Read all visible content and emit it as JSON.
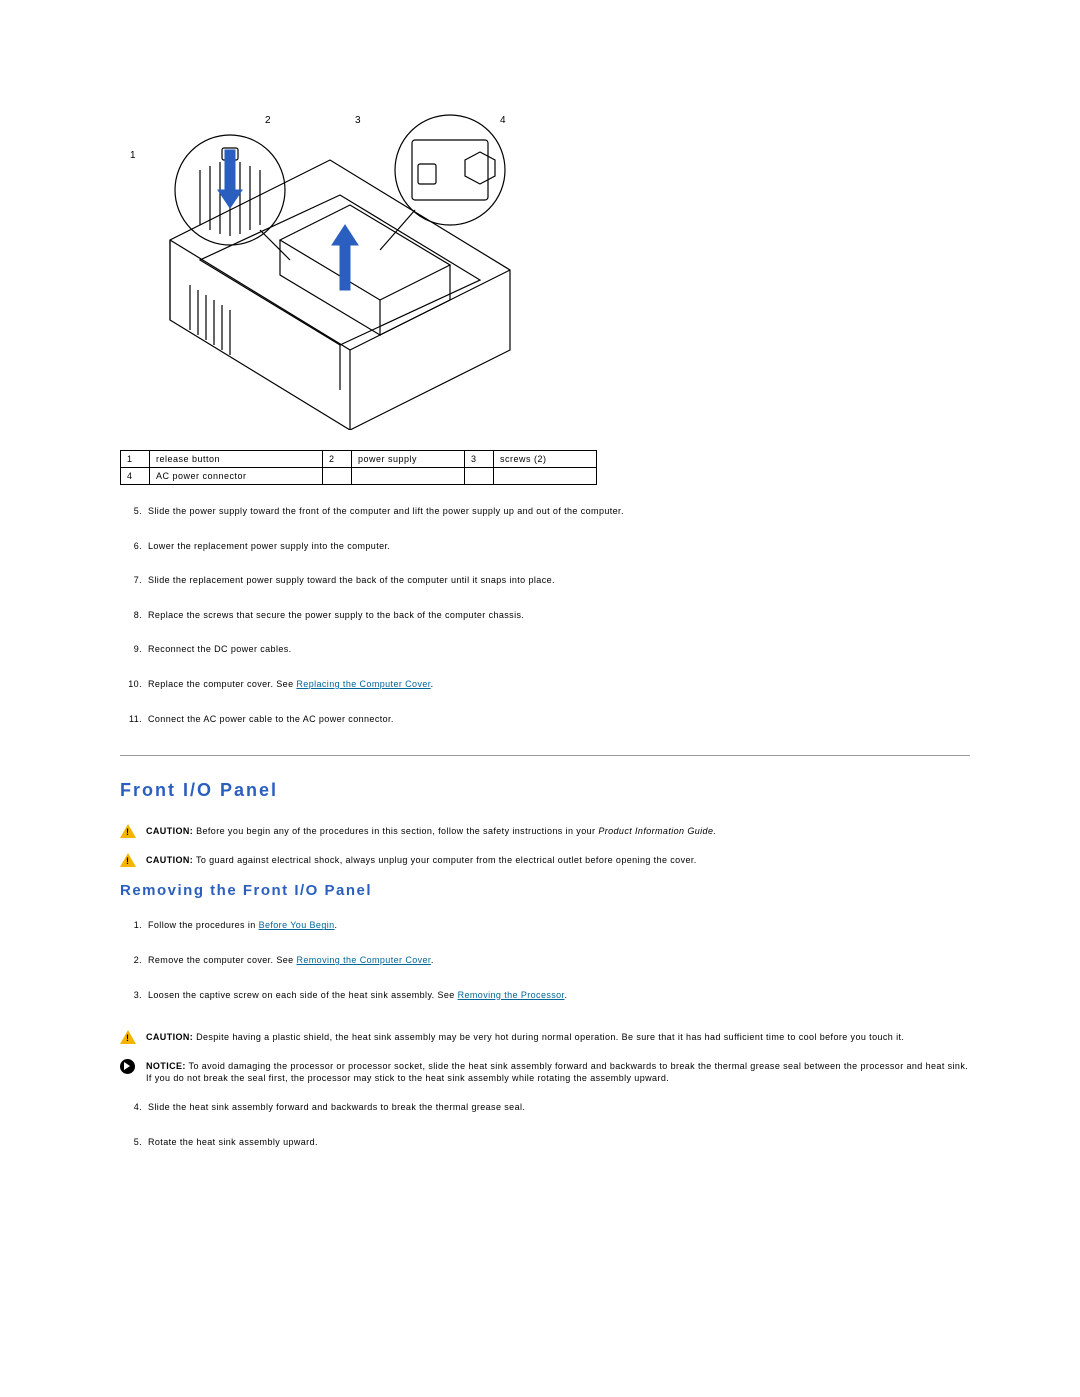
{
  "figure": {
    "callouts": {
      "c1": "1",
      "c2": "2",
      "c3": "3",
      "c4": "4"
    }
  },
  "legend": {
    "r1": {
      "n1": "1",
      "v1": "release button",
      "n2": "2",
      "v2": "power supply",
      "n3": "3",
      "v3": "screws (2)"
    },
    "r2": {
      "n4": "4",
      "v4": "AC power connector"
    }
  },
  "steps_a": [
    {
      "n": "5.",
      "text": "Slide the power supply toward the front of the computer and lift the power supply up and out of the computer."
    },
    {
      "n": "6.",
      "text": "Lower the replacement power supply into the computer."
    },
    {
      "n": "7.",
      "text": "Slide the replacement power supply toward the back of the computer until it snaps into place."
    },
    {
      "n": "8.",
      "text": "Replace the screws that secure the power supply to the back of the computer chassis."
    },
    {
      "n": "9.",
      "text": "Reconnect the DC power cables."
    },
    {
      "n": "10.",
      "pre": "Replace the computer cover. See ",
      "link": "Replacing the Computer Cover",
      "post": "."
    },
    {
      "n": "11.",
      "text": "Connect the AC power cable to the AC power connector."
    }
  ],
  "h2": "Front I/O Panel",
  "caution1": {
    "lead": "CAUTION:",
    "text": " Before you begin any of the procedures in this section, follow the safety instructions in your ",
    "emph": "Product Information Guide.",
    "tail": ""
  },
  "caution2": {
    "lead": "CAUTION:",
    "text": " To guard against electrical shock, always unplug your computer from the electrical outlet before opening the cover."
  },
  "h3": "Removing the Front I/O Panel",
  "steps_b": [
    {
      "n": "1.",
      "pre": "Follow the procedures in ",
      "link": "Before You Begin",
      "post": "."
    },
    {
      "n": "2.",
      "pre": "Remove the computer cover. See ",
      "link": "Removing the Computer Cover",
      "post": "."
    },
    {
      "n": "3.",
      "pre": "Loosen the captive screw on each side of the heat sink assembly. See ",
      "link": "Removing the Processor",
      "post": "."
    }
  ],
  "caution3": {
    "lead": "CAUTION:",
    "text": " Despite having a plastic shield, the heat sink assembly may be very hot during normal operation. Be sure that it has had sufficient time to cool before you touch it."
  },
  "notice": {
    "lead": "NOTICE:",
    "text": " To avoid damaging the processor or processor socket, slide the heat sink assembly forward and backwards to break the thermal grease seal between the processor and heat sink. If you do not break the seal first, the processor may stick to the heat sink assembly while rotating the assembly upward."
  },
  "steps_c": [
    {
      "n": "4.",
      "text": "Slide the heat sink assembly forward and backwards to break the thermal grease seal."
    },
    {
      "n": "5.",
      "text": "Rotate the heat sink assembly upward."
    }
  ]
}
